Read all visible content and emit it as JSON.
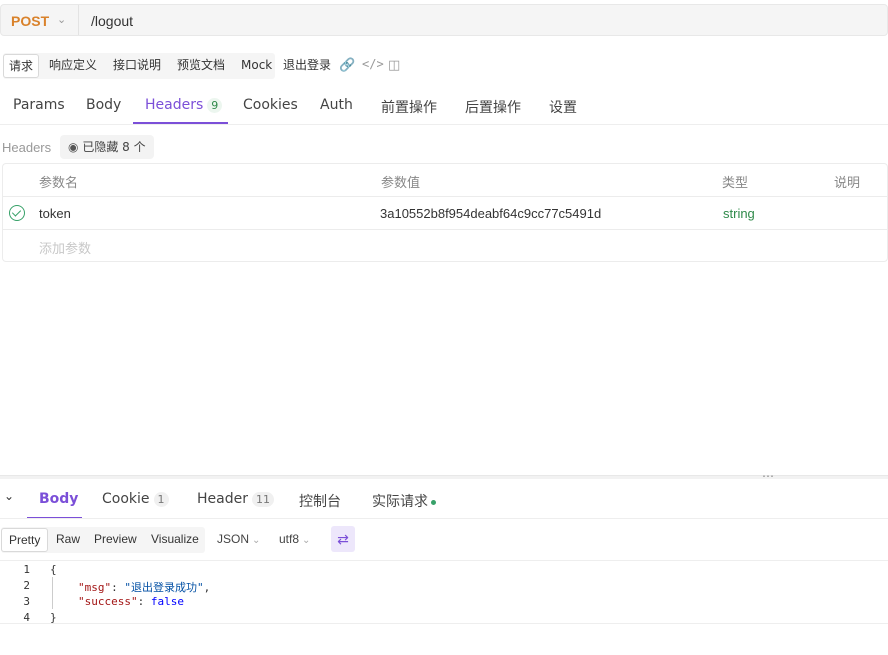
{
  "request": {
    "method": "POST",
    "url": "/logout"
  },
  "sub_tabs": [
    "请求",
    "响应定义",
    "接口说明",
    "预览文档",
    "Mock"
  ],
  "endpoint_name": "退出登录",
  "tabs": {
    "params": "Params",
    "body": "Body",
    "headers": "Headers",
    "headers_count": "9",
    "cookies": "Cookies",
    "auth": "Auth",
    "pre": "前置操作",
    "post": "后置操作",
    "settings": "设置"
  },
  "headers_section": {
    "label": "Headers",
    "hidden_text": "已隐藏 8 个",
    "columns": [
      "参数名",
      "参数值",
      "类型",
      "说明"
    ],
    "rows": [
      {
        "name": "token",
        "value": "3a10552b8f954deabf64c9cc77c5491d",
        "type": "string",
        "desc": ""
      }
    ],
    "add_placeholder": "添加参数"
  },
  "response": {
    "tabs": {
      "body": "Body",
      "cookie": "Cookie",
      "cookie_count": "1",
      "header": "Header",
      "header_count": "11",
      "console": "控制台",
      "actual": "实际请求"
    },
    "formats": [
      "Pretty",
      "Raw",
      "Preview",
      "Visualize"
    ],
    "lang": "JSON",
    "encoding": "utf8",
    "code": {
      "line_numbers": [
        "1",
        "2",
        "3",
        "4"
      ],
      "open": "{",
      "msg_key": "\"msg\"",
      "msg_val": "\"退出登录成功\"",
      "success_key": "\"success\"",
      "success_val": "false",
      "close": "}"
    }
  },
  "colors": {
    "accent": "#7b4fd8",
    "method": "#d9822b",
    "success": "#38a169"
  }
}
